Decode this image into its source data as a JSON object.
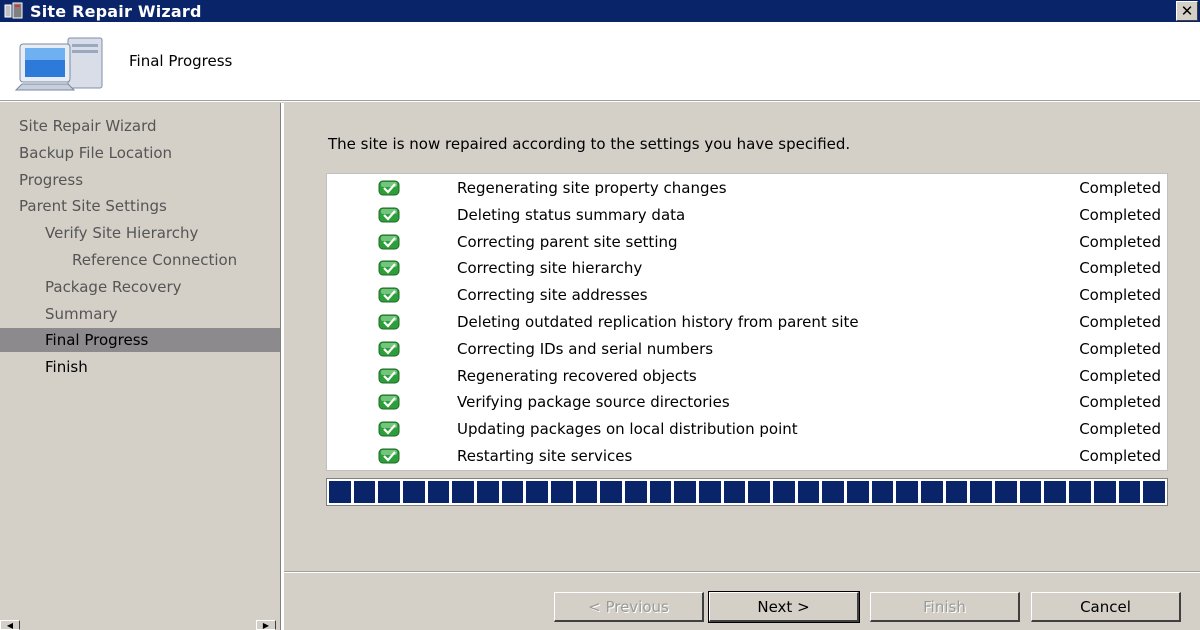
{
  "window": {
    "title": "Site Repair Wizard",
    "close_glyph": "✕"
  },
  "header": {
    "title": "Final Progress",
    "icon": "computer-icon"
  },
  "sidebar": {
    "items": [
      {
        "label": "Site Repair Wizard",
        "indent": 0,
        "state": "done"
      },
      {
        "label": "Backup File Location",
        "indent": 0,
        "state": "done"
      },
      {
        "label": "Progress",
        "indent": 0,
        "state": "done"
      },
      {
        "label": "Parent Site Settings",
        "indent": 0,
        "state": "done"
      },
      {
        "label": "Verify Site Hierarchy",
        "indent": 1,
        "state": "done"
      },
      {
        "label": "Reference Connection",
        "indent": 2,
        "state": "done"
      },
      {
        "label": "Package Recovery",
        "indent": 1,
        "state": "done"
      },
      {
        "label": "Summary",
        "indent": 1,
        "state": "done"
      },
      {
        "label": "Final Progress",
        "indent": 1,
        "state": "active"
      },
      {
        "label": "Finish",
        "indent": 1,
        "state": "next"
      }
    ]
  },
  "main": {
    "intro": "The site is now repaired according to the settings you have specified.",
    "tasks": [
      {
        "name": "Regenerating site property changes",
        "status": "Completed"
      },
      {
        "name": "Deleting status summary data",
        "status": "Completed"
      },
      {
        "name": "Correcting parent site setting",
        "status": "Completed"
      },
      {
        "name": "Correcting site hierarchy",
        "status": "Completed"
      },
      {
        "name": "Correcting site addresses",
        "status": "Completed"
      },
      {
        "name": "Deleting outdated replication history from parent site",
        "status": "Completed"
      },
      {
        "name": "Correcting IDs and serial numbers",
        "status": "Completed"
      },
      {
        "name": "Regenerating recovered objects",
        "status": "Completed"
      },
      {
        "name": "Verifying package source directories",
        "status": "Completed"
      },
      {
        "name": "Updating packages on local distribution point",
        "status": "Completed"
      },
      {
        "name": "Restarting site services",
        "status": "Completed"
      }
    ],
    "progress_percent": 100
  },
  "buttons": {
    "previous": {
      "label": "< Previous",
      "enabled": false
    },
    "next": {
      "label": "Next >",
      "enabled": true
    },
    "finish": {
      "label": "Finish",
      "enabled": false
    },
    "cancel": {
      "label": "Cancel",
      "enabled": true
    }
  },
  "colors": {
    "titlebar": "#0a246a",
    "progress": "#0a246a",
    "check": "#2e9e3a",
    "active_nav": "#8c8a8c"
  }
}
